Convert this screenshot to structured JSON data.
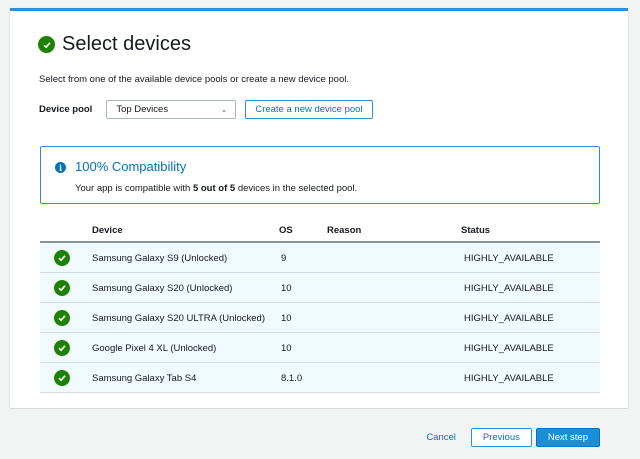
{
  "header": {
    "title": "Select devices"
  },
  "description": "Select from one of the available device pools or create a new device pool.",
  "pool": {
    "label": "Device pool",
    "selected": "Top Devices",
    "create_label": "Create a new device pool"
  },
  "info": {
    "title": "100% Compatibility",
    "text_prefix": "Your app is compatible with ",
    "text_bold": "5 out of 5",
    "text_suffix": " devices in the selected pool."
  },
  "table": {
    "headers": {
      "device": "Device",
      "os": "OS",
      "reason": "Reason",
      "status": "Status"
    },
    "rows": [
      {
        "device": "Samsung Galaxy S9 (Unlocked)",
        "os": "9",
        "reason": "",
        "status": "HIGHLY_AVAILABLE"
      },
      {
        "device": "Samsung Galaxy S20 (Unlocked)",
        "os": "10",
        "reason": "",
        "status": "HIGHLY_AVAILABLE"
      },
      {
        "device": "Samsung Galaxy S20 ULTRA (Unlocked)",
        "os": "10",
        "reason": "",
        "status": "HIGHLY_AVAILABLE"
      },
      {
        "device": "Google Pixel 4 XL (Unlocked)",
        "os": "10",
        "reason": "",
        "status": "HIGHLY_AVAILABLE"
      },
      {
        "device": "Samsung Galaxy Tab S4",
        "os": "8.1.0",
        "reason": "",
        "status": "HIGHLY_AVAILABLE"
      }
    ]
  },
  "footer": {
    "cancel": "Cancel",
    "previous": "Previous",
    "next": "Next step"
  },
  "icons": {
    "title": "check-circle-icon",
    "info": "info-icon",
    "row": "check-circle-icon",
    "dropdown": "chevron-down-icon"
  },
  "colors": {
    "accent": "#0073bb",
    "success": "#1d8102",
    "row_bg": "#f1faff",
    "primary_button": "#1a8fd6"
  }
}
